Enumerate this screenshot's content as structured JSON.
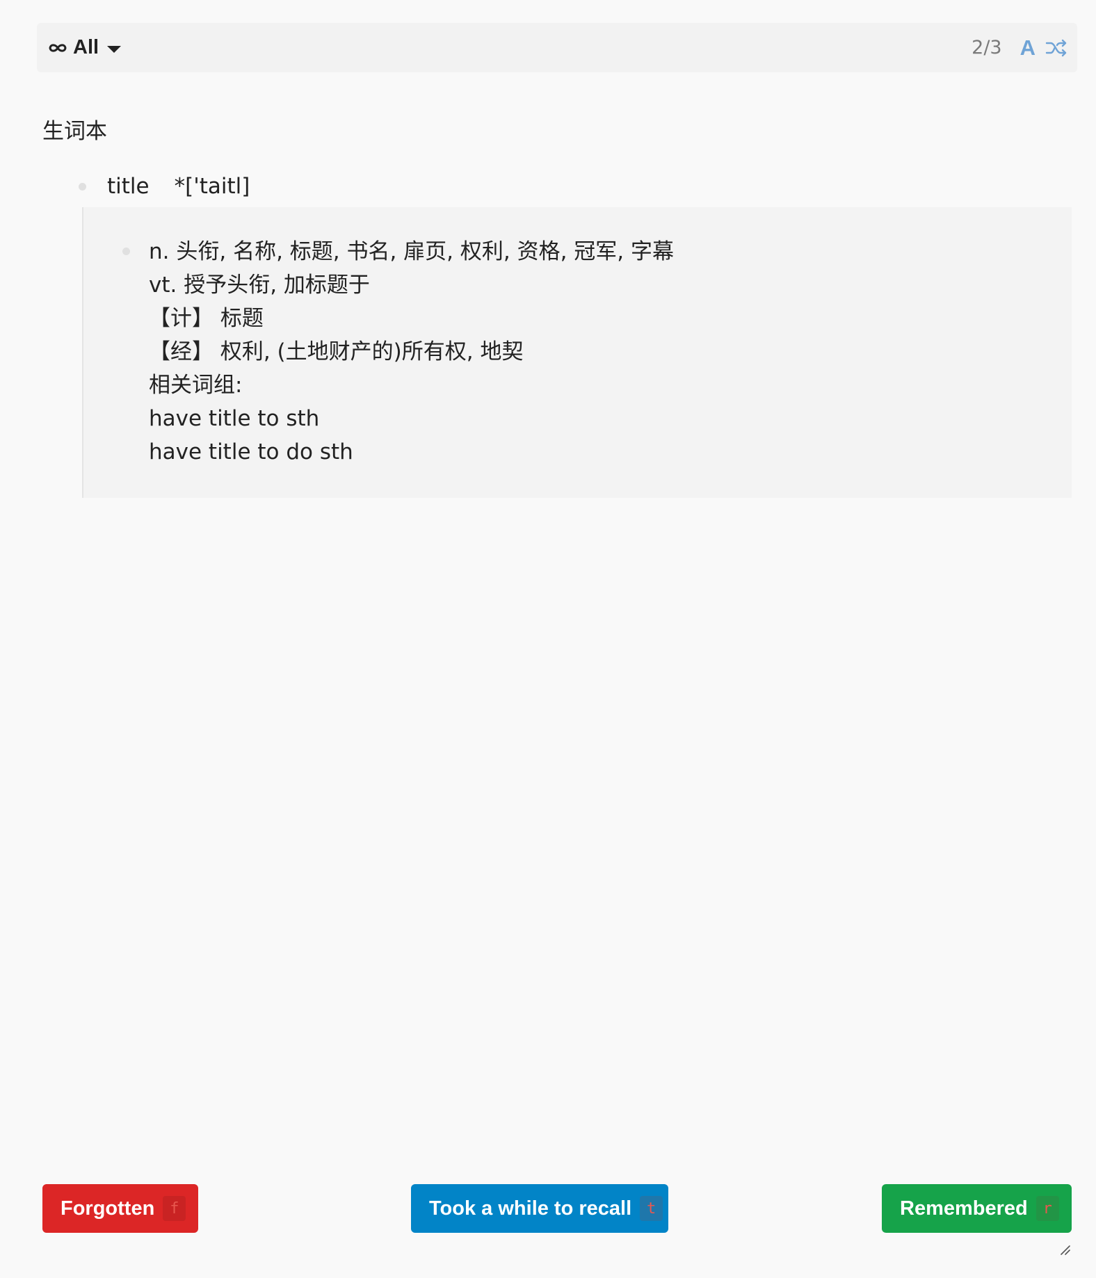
{
  "toolbar": {
    "filter_icon": "infinity-icon",
    "filter_label": "All",
    "filter_caret": "chevron-down-icon",
    "counter": "2/3",
    "font_button_label": "A",
    "shuffle_icon": "shuffle-icon",
    "accent_color": "#6fa3d6"
  },
  "card": {
    "notebook_title": "生词本",
    "word": "title",
    "phonetic": "*['taitl]",
    "definition_lines": [
      "n. 头衔, 名称, 标题, 书名, 扉页, 权利, 资格, 冠军, 字幕",
      "vt. 授予头衔, 加标题于",
      "【计】 标题",
      "【经】 权利, (土地财产的)所有权, 地契",
      "相关词组:",
      "have title to sth",
      "have title to do sth"
    ]
  },
  "actions": {
    "forgotten": {
      "label": "Forgotten",
      "key": "f",
      "color": "#dc2626"
    },
    "took_a_while": {
      "label": "Took a while to recall",
      "key": "t",
      "color": "#0284c7"
    },
    "remembered": {
      "label": "Remembered",
      "key": "r",
      "color": "#16a34a"
    }
  },
  "resize_handle": "resize-handle-icon"
}
